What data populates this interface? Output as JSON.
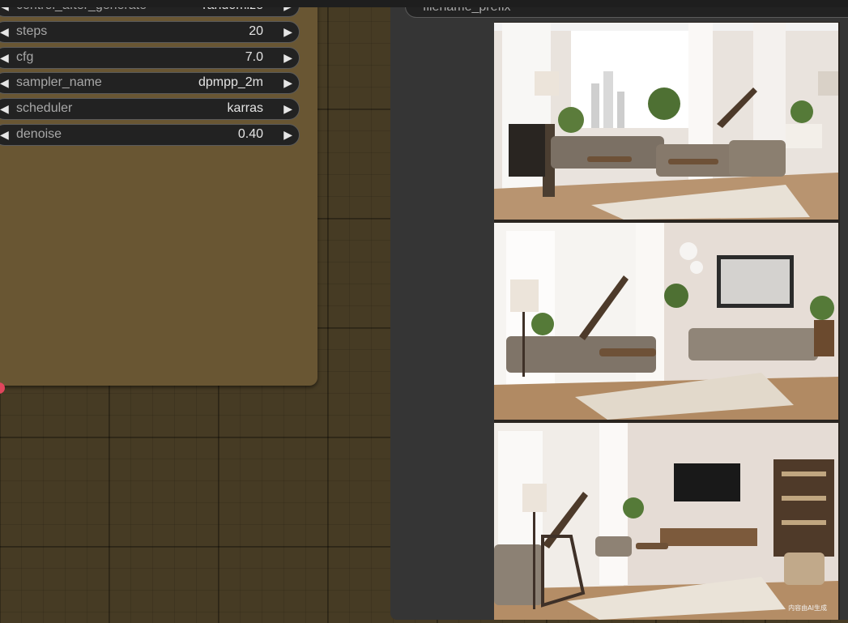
{
  "ksampler": {
    "widgets": [
      {
        "label": "control_after_generate",
        "value": "randomize"
      },
      {
        "label": "steps",
        "value": "20"
      },
      {
        "label": "cfg",
        "value": "7.0"
      },
      {
        "label": "sampler_name",
        "value": "dpmpp_2m"
      },
      {
        "label": "scheduler",
        "value": "karras"
      },
      {
        "label": "denoise",
        "value": "0.40"
      }
    ],
    "arrow_left_glyph": "◀",
    "arrow_right_glyph": "▶"
  },
  "save_image": {
    "filename_prefix_label": "filename_prefix",
    "watermark": "内容由AI生成"
  },
  "colors": {
    "canvas": "#463b24",
    "node_body": "#695633",
    "widget_bg": "#222222",
    "output_node_bg": "#353535"
  }
}
